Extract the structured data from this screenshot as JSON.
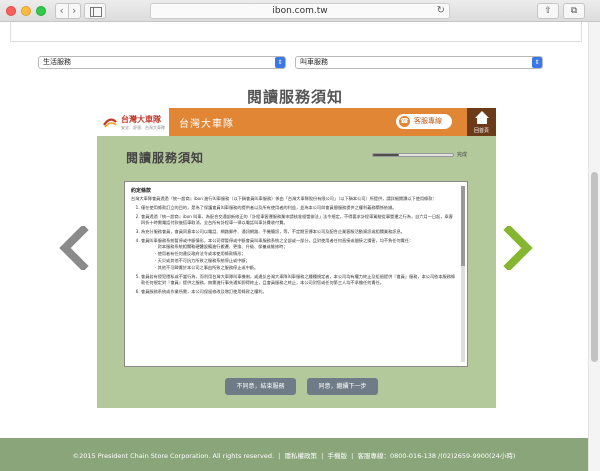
{
  "browser": {
    "url": "ibon.com.tw"
  },
  "selects": {
    "left": "生活服務",
    "right": "叫車服務"
  },
  "page": {
    "title": "閱讀服務須知"
  },
  "banner": {
    "logo_text": "台灣大車隊",
    "logo_sub": "安全．舒適．台灣大車隊",
    "name": "台灣大車隊",
    "hotline_label": "客服專線",
    "home_label": "回首頁"
  },
  "content": {
    "title": "閱讀服務須知",
    "progress_label": "完成",
    "progress": 0.33,
    "terms": {
      "heading": "約定條款",
      "intro": "台灣大車隊會員透過『統一超商』ibon 進行叫車服務（以下稱會員叫車服務）係由「台灣大車隊股份有限公司」（以下稱本公司）所提供，請詳細閱讀以下使用條款：",
      "items": [
        "僅在使用條款訂立的目的，是為了保護會員叫車服務的提供者以及所有使用者的利益，並為本公司與會員間服務提供之權利義務關係依據。",
        "會員透過『統一超商』ibon 叫車，為配合交通部新修正的「計程車客運服務業申請核准經營辦法」法令規定，不得要求計程車駕駛從事營運之行為，自六月一日起，乘客四折十時需電話付款後搭車取消，全台所有計程車一律以電話叫車計費收付費。",
        "為充分服務會員，會員同意本公司以電話、網路郵件、通訊網路、手機簡訊，等，不定期宣傳本公司及配合企業客服活動資訊或相關業務訊息。",
        "會員叫車服務系統暫停或中斷情形，本公司得暫停或中斷會員叫車服務系統之全部或一部分，且對使用者任何直接或間接之損害，均不負任何責任："
      ],
      "subitems": [
        "對本服務系統相關軟硬體設備進行搬遷、更換、升級、保養或維修時；",
        "使用者有任何違反政府法令或本使用條款情形；",
        "天災或其他不可抗力所致之服務系統停止或中斷；",
        "其他不可歸責於本公司之事由所致之服務停止或中斷。"
      ],
      "item5": "會員若有侵犯隱私或不當行為，而利用台灣大車隊叫車機制，或違反台灣大車隊叫車服務之種種規定者，本公司均有權力終止及拒絕提供『會員』服務，本公司依本服務條款任何規定對『會員』提供之服務，無需進行事先通知即得終止，且會員服務之終止，本公司對您或任何第三人均不承擔任何責任。",
      "item6": "會員服務系統或作業所需，本公司保留修改及增訂使用條款之權利。"
    },
    "decline_label": "不同意，結束服務",
    "accept_label": "同意，繼續下一步"
  },
  "footer": {
    "copyright": "©2015 President Chain Store Corporation. All rights reserved.",
    "privacy": "隱私權政策",
    "mobile": "手機版",
    "service": "客服專線：0800-016-138 /(02)2659-9900(24小時)"
  }
}
